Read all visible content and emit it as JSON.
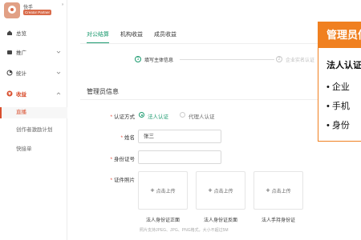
{
  "app": {
    "logo_name": "快手",
    "logo_badge": "Creator Partner",
    "logo_extra": "’"
  },
  "sidebar": {
    "items": [
      {
        "label": "总览",
        "icon": "home-icon"
      },
      {
        "label": "推广",
        "icon": "folder-icon"
      },
      {
        "label": "统计",
        "icon": "chart-icon"
      },
      {
        "label": "收益",
        "icon": "money-icon"
      }
    ],
    "sub_items": [
      {
        "label": "直播"
      },
      {
        "label": "创作者激励计划"
      },
      {
        "label": "快接单"
      }
    ]
  },
  "tabs": [
    {
      "label": "对公结算"
    },
    {
      "label": "机构收益"
    },
    {
      "label": "成员收益"
    }
  ],
  "steps": [
    {
      "num": "1",
      "label": "填写主体信息"
    },
    {
      "num": "2",
      "label": "企业实名认证"
    }
  ],
  "form": {
    "section_title": "管理员信息",
    "auth_method_label": "认证方式",
    "auth_options": [
      "法人认证",
      "代理人认证"
    ],
    "name_label": "姓名",
    "name_value": "张三",
    "id_label": "身份证号",
    "id_value": "",
    "photo_label": "证件照片",
    "upload_text": "点击上传",
    "captions": [
      "法人身份证正面",
      "法人身份证反面",
      "法人手持身份证"
    ],
    "hint": "照片支持JPEG、JPG、PNG格式，大小不超过5M"
  },
  "overlay": {
    "title": "管理员信息",
    "subtitle": "法人认证",
    "bullets": [
      "企业",
      "手机",
      "身份"
    ]
  },
  "colors": {
    "accent_green": "#1a9a6e",
    "accent_red": "#d94f2e",
    "overlay_orange": "#f08020"
  }
}
